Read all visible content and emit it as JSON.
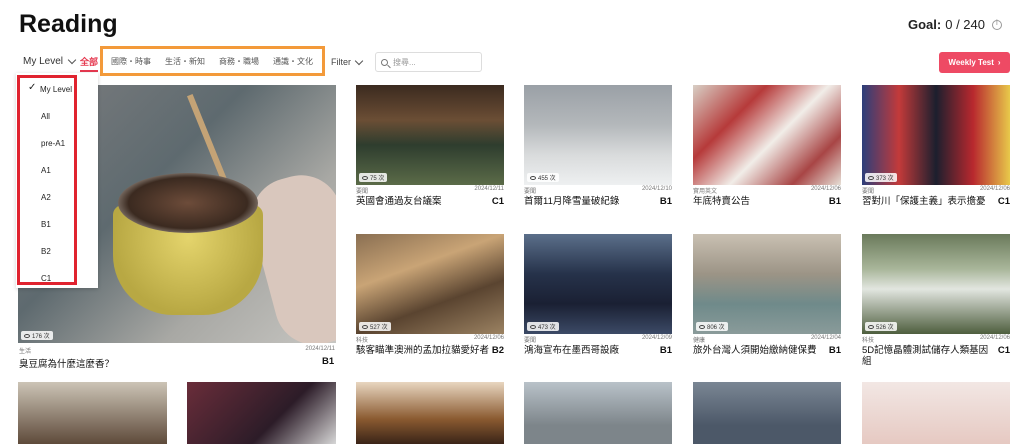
{
  "header": {
    "title": "Reading",
    "goal_label": "Goal:",
    "goal_value": "0 / 240"
  },
  "filters": {
    "level_select": "My Level",
    "tab_all": "全部",
    "categories": [
      "國際・時事",
      "生活・新知",
      "商務・職場",
      "通識・文化"
    ],
    "filter_label": "Filter",
    "search_placeholder": "搜尋...",
    "weekly_test": "Weekly Test",
    "highlight_color": "#f39a3a",
    "accent_color": "#ee4a64"
  },
  "dropdown": {
    "selected": "My Level",
    "items": [
      "My Level",
      "All",
      "pre-A1",
      "A1",
      "A2",
      "B1",
      "B2",
      "C1"
    ],
    "highlight_color": "#e0232f"
  },
  "featured": {
    "views": "176 次",
    "category": "生活",
    "date": "2024/12/11",
    "title": "臭豆腐為什麼這麼香？",
    "level": "B1"
  },
  "articles": [
    {
      "views": "75 次",
      "category": "要聞",
      "date": "2024/12/11",
      "title": "英國會通過友台議案",
      "level": "C1"
    },
    {
      "views": "455 次",
      "category": "要聞",
      "date": "2024/12/10",
      "title": "首爾11月降雪量破紀錄",
      "level": "B1"
    },
    {
      "views": "",
      "category": "實用英文",
      "date": "2024/12/06",
      "title": "年底特賣公告",
      "level": "B1"
    },
    {
      "views": "373 次",
      "category": "要聞",
      "date": "2024/12/06",
      "title": "習對川「保護主義」表示擔憂",
      "level": "C1"
    },
    {
      "views": "527 次",
      "category": "科技",
      "date": "2024/12/06",
      "title": "駭客瞄準澳洲的孟加拉貓愛好者",
      "level": "B2"
    },
    {
      "views": "473 次",
      "category": "要聞",
      "date": "2024/12/09",
      "title": "鴻海宣布在墨西哥設廠",
      "level": "B1"
    },
    {
      "views": "806 次",
      "category": "健康",
      "date": "2024/12/04",
      "title": "旅外台灣人須開始繳納健保費",
      "level": "B1"
    },
    {
      "views": "526 次",
      "category": "科技",
      "date": "2024/12/06",
      "title": "5D記憶晶體測試儲存人類基因組",
      "level": "C1"
    }
  ]
}
